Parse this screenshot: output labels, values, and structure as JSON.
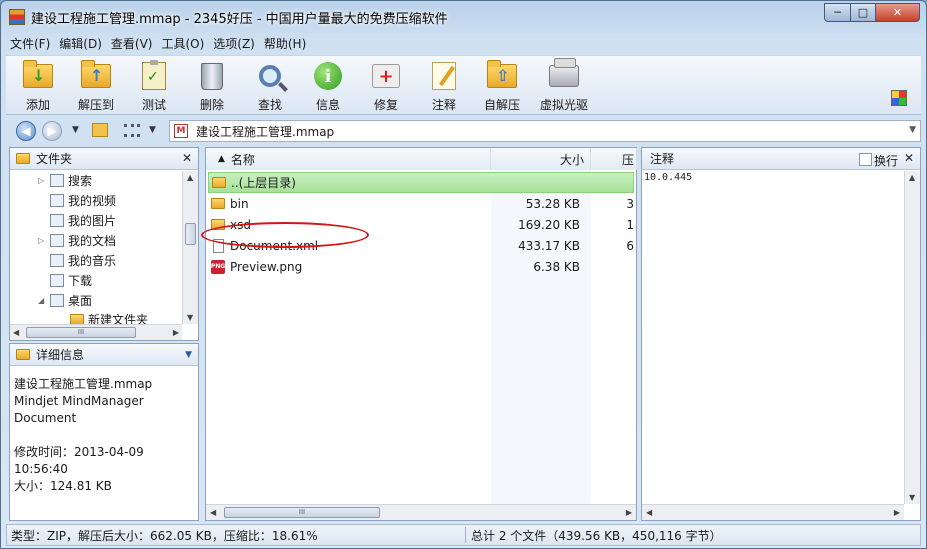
{
  "window": {
    "title": "建设工程施工管理.mmap - 2345好压 - 中国用户量最大的免费压缩软件",
    "min_glyph": "─",
    "max_glyph": "□",
    "close_glyph": "✕"
  },
  "menu": [
    "文件(F)",
    "编辑(D)",
    "查看(V)",
    "工具(O)",
    "选项(Z)",
    "帮助(H)"
  ],
  "toolbar": [
    {
      "label": "添加",
      "icon": "add-folder-icon"
    },
    {
      "label": "解压到",
      "icon": "extract-folder-icon"
    },
    {
      "label": "测试",
      "icon": "test-clipboard-icon"
    },
    {
      "label": "删除",
      "icon": "trash-icon"
    },
    {
      "label": "查找",
      "icon": "magnifier-icon"
    },
    {
      "label": "信息",
      "icon": "info-icon"
    },
    {
      "label": "修复",
      "icon": "first-aid-icon"
    },
    {
      "label": "注释",
      "icon": "note-pencil-icon"
    },
    {
      "label": "自解压",
      "icon": "self-extract-folder-icon"
    },
    {
      "label": "虚拟光驱",
      "icon": "virtual-drive-icon"
    }
  ],
  "nav": {
    "path": "建设工程施工管理.mmap"
  },
  "tree": {
    "header": "文件夹",
    "items": [
      {
        "label": "搜索"
      },
      {
        "label": "我的视频"
      },
      {
        "label": "我的图片"
      },
      {
        "label": "我的文档"
      },
      {
        "label": "我的音乐"
      },
      {
        "label": "下载"
      },
      {
        "label": "桌面"
      },
      {
        "label": "新建文件夹"
      }
    ],
    "scroll_thumb": "III"
  },
  "details": {
    "header": "详细信息",
    "filename": "建设工程施工管理.mmap",
    "type_line1": "Mindjet MindManager",
    "type_line2": "Document",
    "modified": "修改时间：2013-04-09 10:56:40",
    "size": "大小：124.81 KB"
  },
  "files": {
    "col_name": "名称",
    "col_size": "大小",
    "col_comp": "压",
    "rows": [
      {
        "name": "..(上层目录)",
        "size": "",
        "comp": ""
      },
      {
        "name": "bin",
        "size": "53.28 KB",
        "comp": "3"
      },
      {
        "name": "xsd",
        "size": "169.20 KB",
        "comp": "1"
      },
      {
        "name": "Document.xml",
        "size": "433.17 KB",
        "comp": "6"
      },
      {
        "name": "Preview.png",
        "size": "6.38 KB",
        "comp": ""
      }
    ],
    "scroll_thumb": "III",
    "png_badge": "PNG"
  },
  "notes": {
    "header": "注释",
    "wrap_label": "换行",
    "text": "10.0.445"
  },
  "status": {
    "left": "类型：ZIP，解压后大小：662.05 KB，压缩比：18.61%",
    "right": "总计 2 个文件（439.56 KB，450,116 字节）"
  },
  "colors": {
    "annotation": "#d41616",
    "parent_row": "#b5e6a8"
  }
}
